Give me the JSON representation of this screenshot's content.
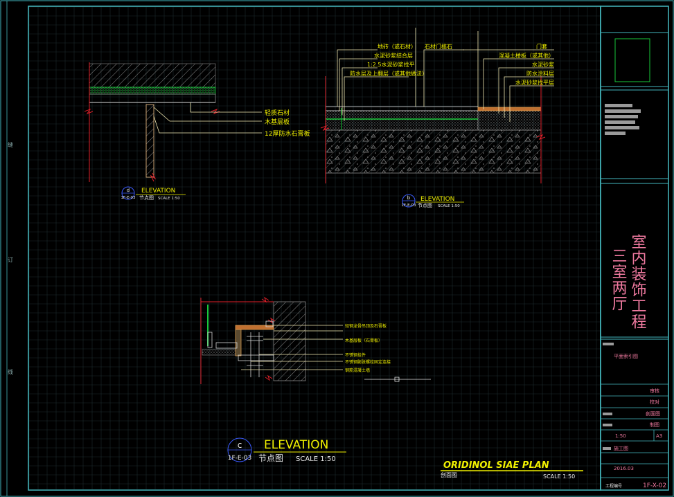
{
  "detail_a": {
    "callout_tag": "d",
    "callout_ref": "1F-E-03",
    "title": "ELEVATION",
    "subtitle": "节点图",
    "scale": "SCALE  1:50",
    "notes": [
      "轻质石材",
      "木基层板",
      "12厚防水石膏板"
    ]
  },
  "detail_b": {
    "callout_tag": "b",
    "callout_ref": "1F-E-03",
    "title": "ELEVATION",
    "subtitle": "节点图",
    "scale": "SCALE  1:50",
    "notes_left": [
      "地砖（或石材）",
      "水泥砂浆结合层",
      "1:2.5水泥砂浆找平",
      "防水层及上翻层（或其他做法）"
    ],
    "note_center": "石材门槛石",
    "notes_right": [
      "门套",
      "混凝土楼板（或其他）",
      "水泥砂浆",
      "防水涂料层",
      "水泥砂浆找平层"
    ]
  },
  "detail_c": {
    "callout_tag": "c",
    "callout_ref": "1F-E-03",
    "title": "ELEVATION",
    "subtitle": "节点图",
    "scale": "SCALE  1:50",
    "notes": [
      "轻钢龙骨吊顶及石膏板",
      "木基层板（石膏板）",
      "不锈钢挂件",
      "不锈钢膨胀螺栓固定连接",
      "钢筋混凝土墙"
    ]
  },
  "sheet_title": {
    "title": "ORIDINOL SIAE   PLAN",
    "subtitle": "剖面图",
    "scale": "SCALE  1:50"
  },
  "title_block": {
    "project_line1": "三室两厅",
    "project_line2": "室内装饰工程",
    "drawing_name": "平面索引图",
    "rows": [
      "审核",
      "校对",
      "剖面图",
      "制图"
    ],
    "scale": "1:50",
    "paper": "A3",
    "stage": "施工图",
    "date": "2016.03",
    "drawing_no_label": "工程编号",
    "drawing_no": "1F-X-02"
  },
  "colors": {
    "border": "#45b9bf",
    "grid": "#1c2a2c",
    "note_yellow": "#f0f000",
    "leader": "#f2e9b2",
    "hatch": "#8a8a8a",
    "green": "#18c93a",
    "section_red": "#e0202a",
    "callout_blue": "#3b5bff",
    "pink": "#f07aa0"
  }
}
